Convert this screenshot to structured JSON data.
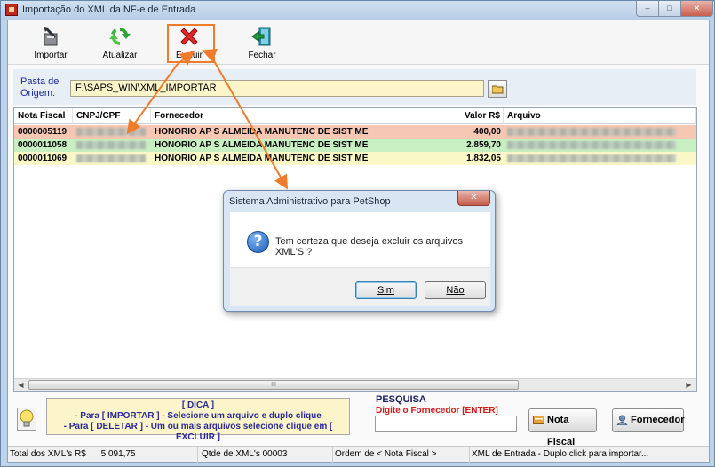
{
  "window": {
    "title": "Importação do XML da NF-e de Entrada",
    "controls": {
      "minimize": "–",
      "maximize": "□",
      "close": "✕"
    }
  },
  "toolbar": {
    "items": [
      {
        "label": "Importar",
        "icon": "import-icon"
      },
      {
        "label": "Atualizar",
        "icon": "refresh-icon"
      },
      {
        "label": "Excluir",
        "icon": "delete-icon"
      },
      {
        "label": "Fechar",
        "icon": "exit-icon"
      }
    ]
  },
  "path": {
    "label_line1": "Pasta de",
    "label_line2": "Origem:",
    "value": "F:\\SAPS_WIN\\XML_IMPORTAR"
  },
  "grid": {
    "columns": [
      "Nota Fiscal",
      "CNPJ/CPF",
      "Fornecedor",
      "Valor R$",
      "Arquivo"
    ],
    "rows": [
      {
        "nota": "0000005119",
        "fornecedor": "HONORIO AP S ALMEIDA MANUTENC DE SIST ME",
        "valor": "400,00",
        "bg": "#f6c7b2"
      },
      {
        "nota": "0000011058",
        "fornecedor": "HONORIO AP S ALMEIDA MANUTENC DE SIST ME",
        "valor": "2.859,70",
        "bg": "#c8efc2"
      },
      {
        "nota": "0000011069",
        "fornecedor": "HONORIO AP S ALMEIDA MANUTENC DE SIST ME",
        "valor": "1.832,05",
        "bg": "#fbf8c8"
      }
    ],
    "scroll_grip": "III"
  },
  "dica": {
    "title": "[ DICA ]",
    "line1": "- Para [ IMPORTAR ] - Selecione um arquivo e duplo clique",
    "line2": "- Para [ DELETAR ] - Um ou mais arquivos selecione clique em [ EXCLUIR ]"
  },
  "pesquisa": {
    "title": "PESQUISA",
    "subtitle": "Digite o Fornecedor [ENTER]",
    "value": ""
  },
  "buttons": {
    "nota_fiscal": "Nota Fiscal",
    "fornecedor": "Fornecedor"
  },
  "status": {
    "total_label": "Total dos XML's R$",
    "total_value": "5.091,75",
    "qtde": "Qtde de XML's 00003",
    "ordem": "Ordem de < Nota Fiscal >",
    "hint": "XML de Entrada - Duplo click para importar..."
  },
  "dialog": {
    "title": "Sistema Administrativo para PetShop",
    "message": "Tem certeza que deseja excluir os arquivos XML'S ?",
    "yes": "Sim",
    "no": "Não",
    "icon": "question-icon"
  },
  "colors": {
    "annotation": "#ef7b2b",
    "selected_row": "#f6c7b2",
    "green_row": "#c8efc2",
    "yellow_row": "#fbf8c8"
  }
}
